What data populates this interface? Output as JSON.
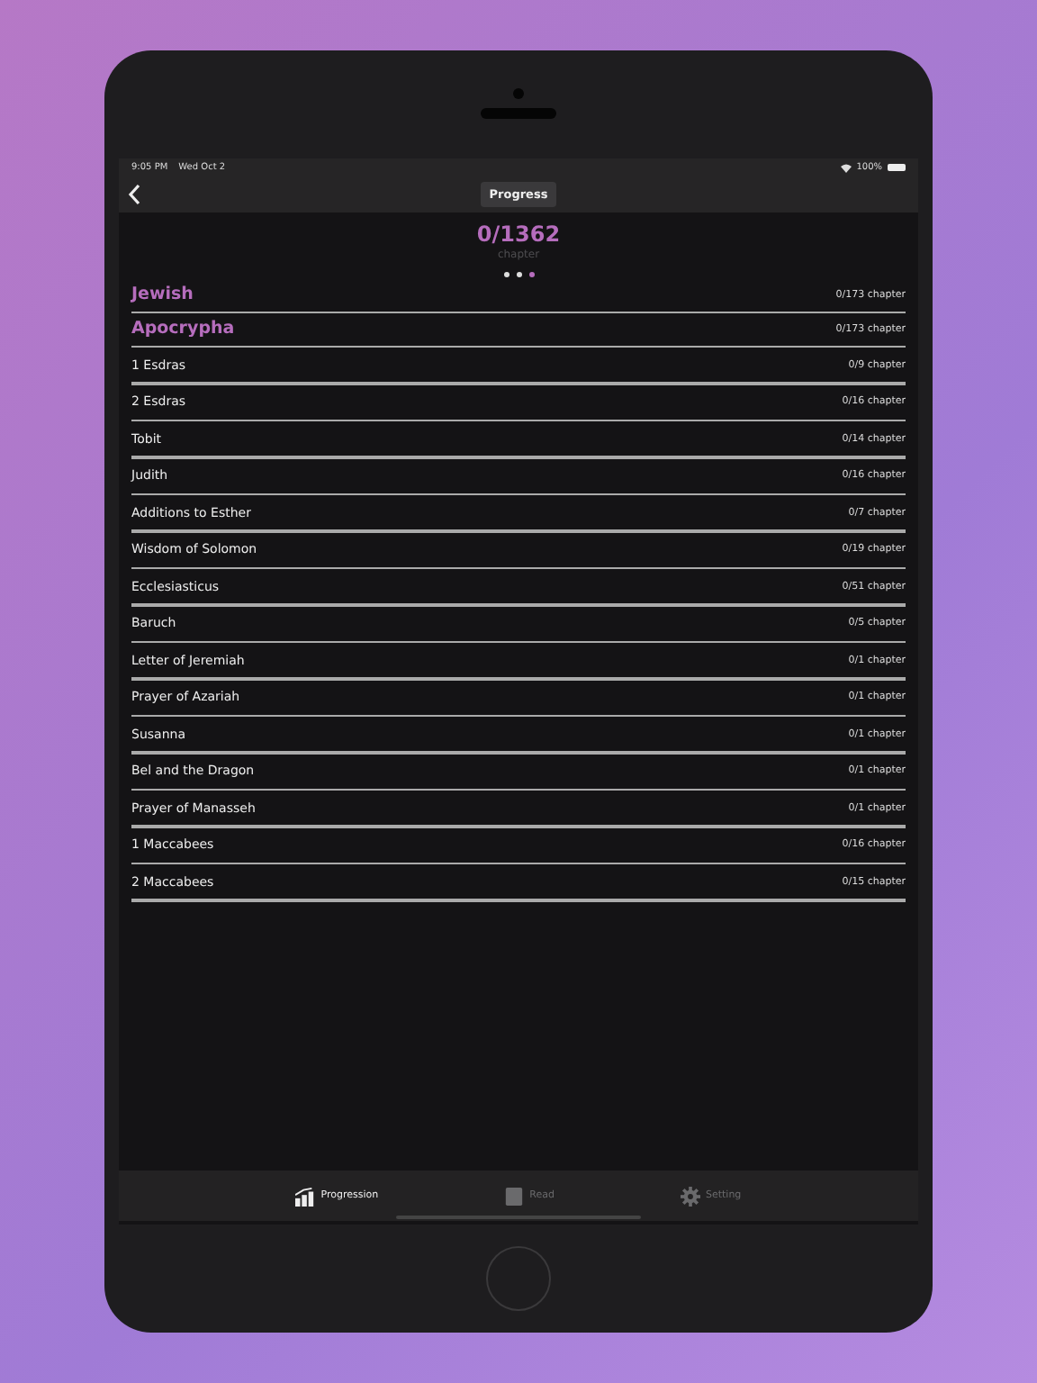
{
  "status_bar": {
    "time": "9:05 PM",
    "date": "Wed Oct 2",
    "battery": "100%"
  },
  "nav": {
    "title": "Progress"
  },
  "summary": {
    "count": "0/1362",
    "unit": "chapter"
  },
  "page_dots": [
    {
      "selected": false
    },
    {
      "selected": false
    },
    {
      "selected": true
    }
  ],
  "rows": [
    {
      "kind": "heading",
      "name": "Jewish",
      "progress": "0/173 chapter",
      "level": 0
    },
    {
      "kind": "heading",
      "name": "Apocrypha",
      "progress": "0/173 chapter",
      "level": 0
    },
    {
      "kind": "book",
      "name": "1 Esdras",
      "progress": "0/9 chapter",
      "level": 0
    },
    {
      "kind": "book",
      "name": "2 Esdras",
      "progress": "0/16 chapter",
      "level": 0
    },
    {
      "kind": "book",
      "name": "Tobit",
      "progress": "0/14 chapter",
      "level": 0
    },
    {
      "kind": "book",
      "name": "Judith",
      "progress": "0/16 chapter",
      "level": 0
    },
    {
      "kind": "book",
      "name": "Additions to Esther",
      "progress": "0/7 chapter",
      "level": 0
    },
    {
      "kind": "book",
      "name": "Wisdom of Solomon",
      "progress": "0/19 chapter",
      "level": 0
    },
    {
      "kind": "book",
      "name": "Ecclesiasticus",
      "progress": "0/51 chapter",
      "level": 0
    },
    {
      "kind": "book",
      "name": "Baruch",
      "progress": "0/5 chapter",
      "level": 0
    },
    {
      "kind": "book",
      "name": "Letter of Jeremiah",
      "progress": "0/1 chapter",
      "level": 0
    },
    {
      "kind": "book",
      "name": "Prayer of Azariah",
      "progress": "0/1 chapter",
      "level": 0
    },
    {
      "kind": "book",
      "name": "Susanna",
      "progress": "0/1 chapter",
      "level": 0
    },
    {
      "kind": "book",
      "name": "Bel and the Dragon",
      "progress": "0/1 chapter",
      "level": 0
    },
    {
      "kind": "book",
      "name": "Prayer of Manasseh",
      "progress": "0/1 chapter",
      "level": 0
    },
    {
      "kind": "book",
      "name": "1 Maccabees",
      "progress": "0/16 chapter",
      "level": 0
    },
    {
      "kind": "book",
      "name": "2 Maccabees",
      "progress": "0/15 chapter",
      "level": 0
    }
  ],
  "tabs": [
    {
      "kind": "chart",
      "label": "Progression",
      "selected": true
    },
    {
      "kind": "book",
      "label": "Read",
      "selected": false
    },
    {
      "kind": "gear",
      "label": "Setting",
      "selected": false
    }
  ]
}
